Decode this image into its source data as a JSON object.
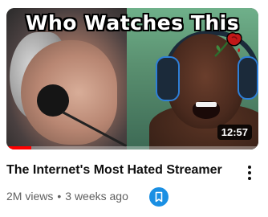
{
  "video": {
    "thumbnail_text": "Who Watches This",
    "duration": "12:57",
    "watch_progress_fraction": 0.1,
    "title": "The Internet's Most Hated Streamer",
    "views": "2M views",
    "separator": "•",
    "age": "3 weeks ago"
  },
  "icons": {
    "thumbnail_decoration": "wilted-rose-icon",
    "menu": "more-vert-icon",
    "save": "bookmark-icon"
  },
  "colors": {
    "progress": "#ff0000",
    "save_badge": "#1a8fe3",
    "title_text": "#0f0f0f",
    "meta_text": "#606060"
  }
}
